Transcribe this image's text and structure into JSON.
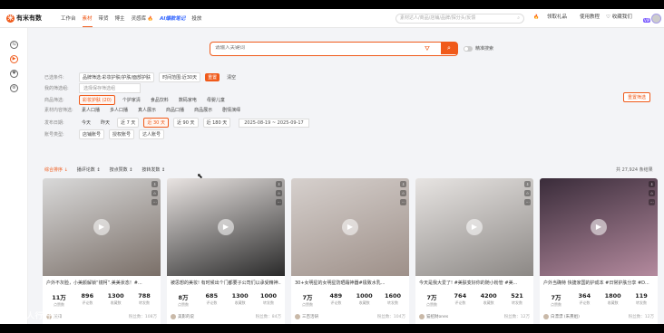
{
  "app": {
    "logo_text": "有米有数",
    "logo_mark": "米"
  },
  "nav": [
    {
      "label": "工作台"
    },
    {
      "label": "素材",
      "active": true
    },
    {
      "label": "带货"
    },
    {
      "label": "博主"
    },
    {
      "label": "灵感库"
    },
    {
      "label": "AI爆款笔记"
    },
    {
      "label": "投放"
    }
  ],
  "top_search": {
    "placeholder": "素材达人/商品/店铺/品牌/探分头/反馈"
  },
  "top_right": {
    "gift": "领取礼品",
    "help": "使用教程",
    "fav": "收藏我们",
    "vip": "VIP"
  },
  "search": {
    "placeholder": "请输入关键词",
    "exact_label": "精准搜索"
  },
  "filters": {
    "row1": {
      "label": "已选条件:",
      "chips": [
        "品牌筛选:彩妆护肤/护肤/面部护肤",
        "时间范围:近30天",
        "清空"
      ],
      "clear_btn": "重置"
    },
    "row2": {
      "label": "我的筛选组:",
      "dropdown": "选择保存筛选组"
    },
    "row3": {
      "label": "商品筛选:",
      "chips": [
        "彩妆护肤 (20)",
        "个护家清",
        "食品饮料",
        "数码家电",
        "母婴儿童"
      ],
      "reset": "重置筛选"
    },
    "row4": {
      "label": "素材内容筛选:",
      "chips": [
        "素人口播",
        "多人口播",
        "真人展示",
        "商品口播",
        "商品展示",
        "剧情演绎"
      ]
    },
    "row5": {
      "label": "发布日期:",
      "chips": [
        "今天",
        "昨天",
        "近 7 天",
        "近 30 天",
        "近 90 天",
        "近 180 天"
      ],
      "date_range": "2025-08-19 ~ 2025-09-17"
    },
    "row6": {
      "label": "账号类型:",
      "chips": [
        "店铺账号",
        "授权账号",
        "达人账号"
      ]
    }
  },
  "sortbar": {
    "items": [
      "综合排序 ↓",
      "播评论数 ↕",
      "按点赞数 ↕",
      "按转发数 ↕"
    ],
    "count": "共 27,924 条结果"
  },
  "cards": [
    {
      "title": "户外不灰脸，小美颜解锁“镜柯”.美美状态！#...",
      "stats": [
        {
          "v": "11万",
          "l": "点赞数"
        },
        {
          "v": "896",
          "l": "评论数"
        },
        {
          "v": "1300",
          "l": "收藏数"
        },
        {
          "v": "788",
          "l": "转发数"
        }
      ],
      "author": "某知",
      "author_meta": "粉丝数：108万",
      "bg": [
        "#d9d9d9",
        "#7a6f68"
      ]
    },
    {
      "title": "被思想的美妆! 有时候出个门都要子公司们以承受精神...",
      "stats": [
        {
          "v": "8万",
          "l": "点赞数"
        },
        {
          "v": "685",
          "l": "评论数"
        },
        {
          "v": "1300",
          "l": "收藏数"
        },
        {
          "v": "1000",
          "l": "转发数"
        }
      ],
      "author": "美影的说",
      "author_meta": "粉丝数：84万",
      "bg": [
        "#e9e4e2",
        "#2a2a2a"
      ]
    },
    {
      "title": "30+女明星的女明星防晒霜神器#极致水乳...",
      "stats": [
        {
          "v": "7万",
          "l": "点赞数"
        },
        {
          "v": "489",
          "l": "评论数"
        },
        {
          "v": "1000",
          "l": "收藏数"
        },
        {
          "v": "1600",
          "l": "转发数"
        }
      ],
      "author": "三百活研",
      "author_meta": "粉丝数：104万",
      "bg": [
        "#d6d0cd",
        "#9e9089"
      ]
    },
    {
      "title": "今天是我大爱了! #美肤变好你的随小粉管 #美...",
      "stats": [
        {
          "v": "7万",
          "l": "点赞数"
        },
        {
          "v": "764",
          "l": "评论数"
        },
        {
          "v": "4200",
          "l": "收藏数"
        },
        {
          "v": "521",
          "l": "转发数"
        }
      ],
      "author": "猫招财ones",
      "author_meta": "粉丝数：12万",
      "bg": [
        "#e7e4e2",
        "#8c8885"
      ]
    },
    {
      "title": "户外当确特 快捷家国的护成本 #日常护肤分享 #D...",
      "stats": [
        {
          "v": "7万",
          "l": "点赞数"
        },
        {
          "v": "364",
          "l": "评论数"
        },
        {
          "v": "1800",
          "l": "收藏数"
        },
        {
          "v": "119",
          "l": "转发数"
        }
      ],
      "author": "白漂漂 (朱熹姐)",
      "author_meta": "粉丝数：12万",
      "bg": [
        "#3a2c3a",
        "#b48a9e"
      ]
    }
  ],
  "watermark": "10一人行好吗"
}
